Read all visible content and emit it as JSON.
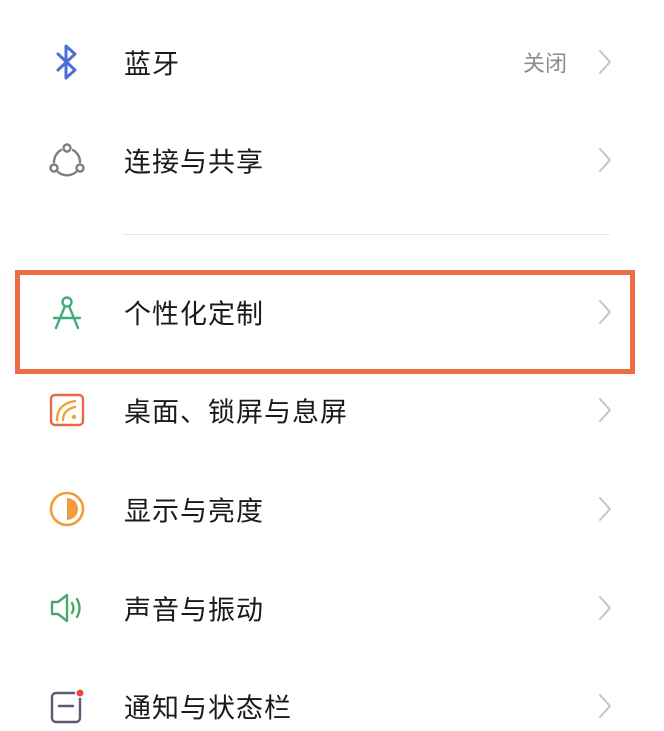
{
  "settings": {
    "items": [
      {
        "id": "bluetooth",
        "label": "蓝牙",
        "value": "关闭",
        "icon": "bluetooth-icon",
        "icon_color": "#4b6fd6"
      },
      {
        "id": "connection-sharing",
        "label": "连接与共享",
        "icon": "connection-share-icon",
        "icon_color": "#7d7d7d"
      },
      {
        "id": "personalization",
        "label": "个性化定制",
        "icon": "compass-icon",
        "icon_color": "#3fae7a"
      },
      {
        "id": "desktop-lockscreen",
        "label": "桌面、锁屏与息屏",
        "icon": "wallpaper-icon",
        "icon_color": "#e26a47"
      },
      {
        "id": "display-brightness",
        "label": "显示与亮度",
        "icon": "brightness-icon",
        "icon_color": "#f29b38"
      },
      {
        "id": "sound-vibration",
        "label": "声音与振动",
        "icon": "speaker-icon",
        "icon_color": "#4aa86b"
      },
      {
        "id": "notification-statusbar",
        "label": "通知与状态栏",
        "icon": "notification-icon",
        "icon_color": "#5a5a78"
      }
    ]
  },
  "highlight": {
    "target": "personalization",
    "color": "#ee6c45"
  }
}
